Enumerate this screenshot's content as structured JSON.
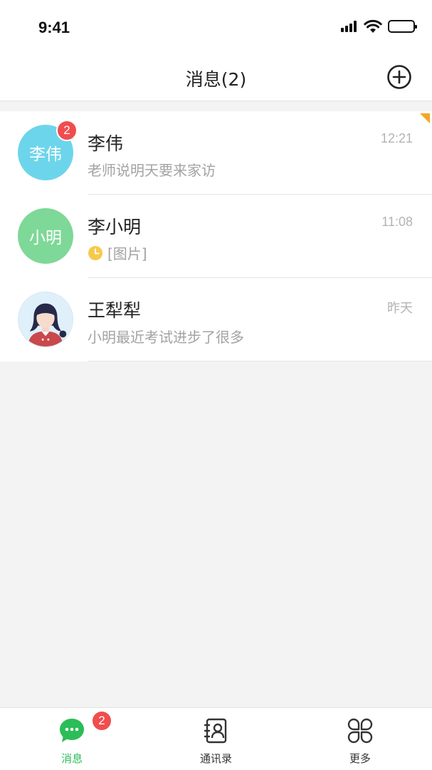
{
  "status_bar": {
    "time": "9:41"
  },
  "header": {
    "title": "消息(2)"
  },
  "chats": [
    {
      "name": "李伟",
      "avatar_text": "李伟",
      "avatar_color": "#6dd5eb",
      "preview": "老师说明天要来家访",
      "time": "12:21",
      "unread": "2",
      "pinned": true
    },
    {
      "name": "李小明",
      "avatar_text": "小明",
      "avatar_color": "#7ed897",
      "preview": "[图片]",
      "time": "11:08",
      "status_icon": "clock-icon"
    },
    {
      "name": "王犁犁",
      "avatar_icon": "girl-avatar",
      "preview": "小明最近考试进步了很多",
      "time": "昨天"
    }
  ],
  "tabs": [
    {
      "label": "消息",
      "icon": "chat-bubble-icon",
      "badge": "2",
      "active": true
    },
    {
      "label": "通讯录",
      "icon": "contacts-book-icon"
    },
    {
      "label": "更多",
      "icon": "grid-more-icon"
    }
  ],
  "colors": {
    "accent": "#2bbd57",
    "badge": "#f14d4d",
    "pin": "#f5a623"
  }
}
